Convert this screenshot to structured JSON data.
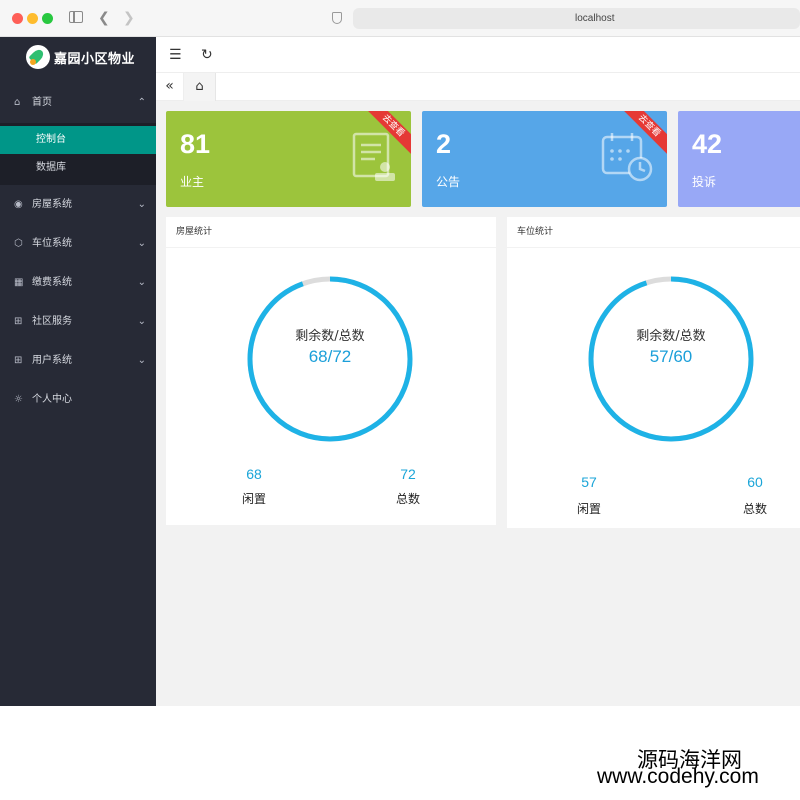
{
  "browser": {
    "url": "localhost"
  },
  "sidebar": {
    "app_title": "嘉园小区物业",
    "home": {
      "label": "首页",
      "icon": "home-icon"
    },
    "home_children": [
      {
        "label": "控制台",
        "active": true
      },
      {
        "label": "数据库",
        "active": false
      }
    ],
    "items": [
      {
        "label": "房屋系统",
        "icon": "house-system-icon"
      },
      {
        "label": "车位系统",
        "icon": "parking-icon"
      },
      {
        "label": "缴费系统",
        "icon": "payment-icon"
      },
      {
        "label": "社区服务",
        "icon": "community-icon"
      },
      {
        "label": "用户系统",
        "icon": "users-icon"
      },
      {
        "label": "个人中心",
        "icon": "personal-icon"
      }
    ]
  },
  "cards": [
    {
      "value": "81",
      "label": "业主",
      "ribbon": "去查看",
      "color": "#9cc43c"
    },
    {
      "value": "2",
      "label": "公告",
      "ribbon": "去查看",
      "color": "#56a6e8"
    },
    {
      "value": "42",
      "label": "投诉",
      "ribbon": "",
      "color": "#98a8f6"
    }
  ],
  "panels": [
    {
      "title": "房屋统计",
      "ring_label": "剩余数/总数",
      "ring_value": "68/72",
      "remaining": 68,
      "total": 72,
      "idle_value": "68",
      "idle_label": "闲置",
      "total_value": "72",
      "total_label": "总数"
    },
    {
      "title": "车位统计",
      "ring_label": "剩余数/总数",
      "ring_value": "57/60",
      "remaining": 57,
      "total": 60,
      "idle_value": "57",
      "idle_label": "闲置",
      "total_value": "60",
      "total_label": "总数"
    }
  ],
  "colors": {
    "ring_fill": "#1eb2e6",
    "ring_track": "#dcdcdc",
    "sidebar_active": "#009688"
  },
  "watermark": {
    "line1": "源码海洋网",
    "line2": "www.codehy.com"
  }
}
